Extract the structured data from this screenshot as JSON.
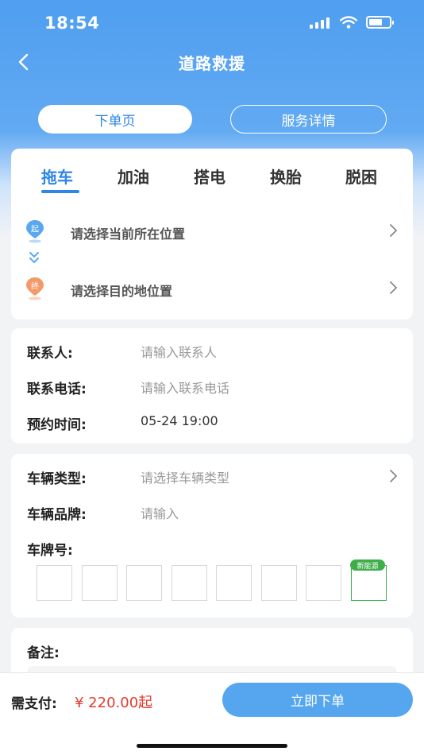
{
  "status_bar": {
    "time": "18:54"
  },
  "header": {
    "title": "道路救援"
  },
  "segments": {
    "order": "下单页",
    "details": "服务详情"
  },
  "tabs": [
    "拖车",
    "加油",
    "搭电",
    "换胎",
    "脱困"
  ],
  "location": {
    "start_badge": "起",
    "start_text": "请选择当前所在位置",
    "end_badge": "终",
    "end_text": "请选择目的地位置"
  },
  "contact": {
    "name_label": "联系人:",
    "name_placeholder": "请输入联系人",
    "phone_label": "联系电话:",
    "phone_placeholder": "请输入联系电话",
    "time_label": "预约时间:",
    "time_value": "05-24 19:00"
  },
  "vehicle": {
    "type_label": "车辆类型:",
    "type_placeholder": "请选择车辆类型",
    "brand_label": "车辆品牌:",
    "brand_placeholder": "请输入",
    "plate_label": "车牌号:",
    "new_energy_badge": "新能源"
  },
  "remarks": {
    "label": "备注:"
  },
  "footer": {
    "pay_label": "需支付:",
    "price": "¥ 220.00起",
    "order_button": "立即下单"
  },
  "colors": {
    "accent": "#2f86e6",
    "header_blue": "#4f9ef0",
    "price_red": "#e23b2e",
    "new_energy_green": "#3fae4a"
  }
}
